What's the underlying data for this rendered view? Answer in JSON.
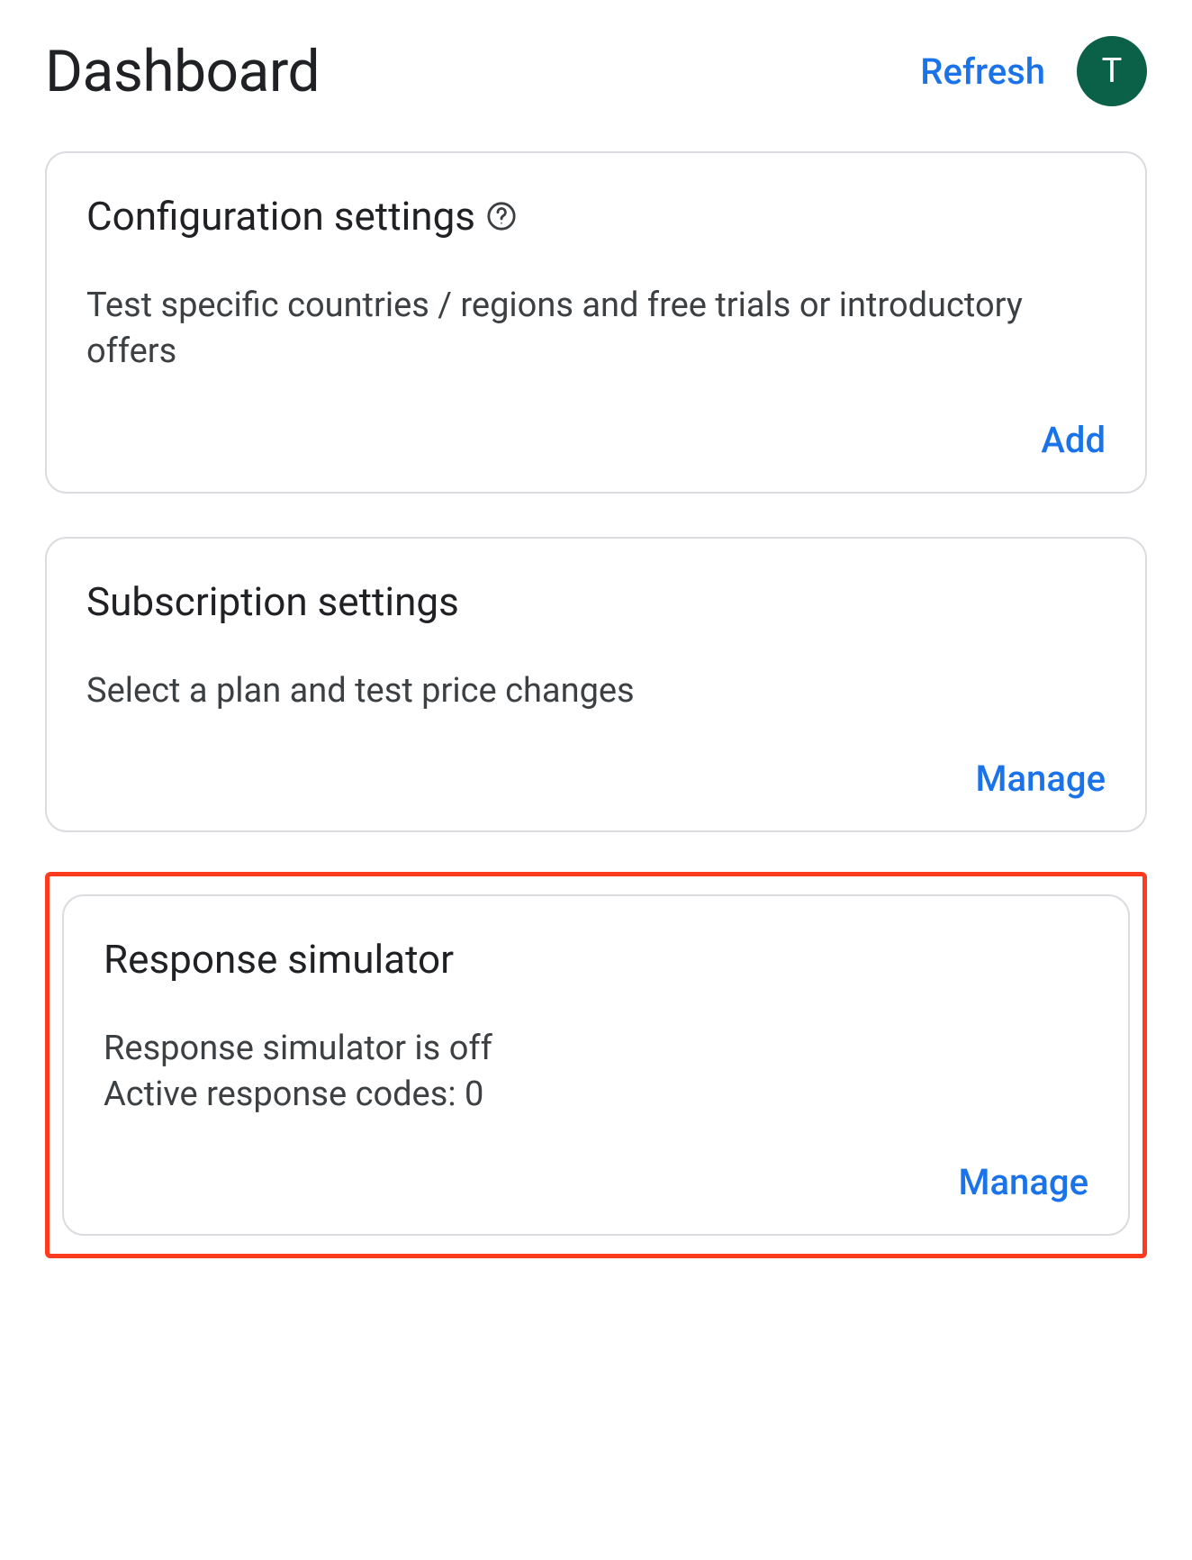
{
  "header": {
    "title": "Dashboard",
    "refresh_label": "Refresh",
    "avatar_initial": "T"
  },
  "cards": {
    "configuration": {
      "title": "Configuration settings",
      "description": "Test specific countries / regions and free trials or introductory offers",
      "action_label": "Add"
    },
    "subscription": {
      "title": "Subscription settings",
      "description": "Select a plan and test price changes",
      "action_label": "Manage"
    },
    "response_simulator": {
      "title": "Response simulator",
      "status_line": "Response simulator is off",
      "codes_line": "Active response codes: 0",
      "action_label": "Manage"
    }
  }
}
